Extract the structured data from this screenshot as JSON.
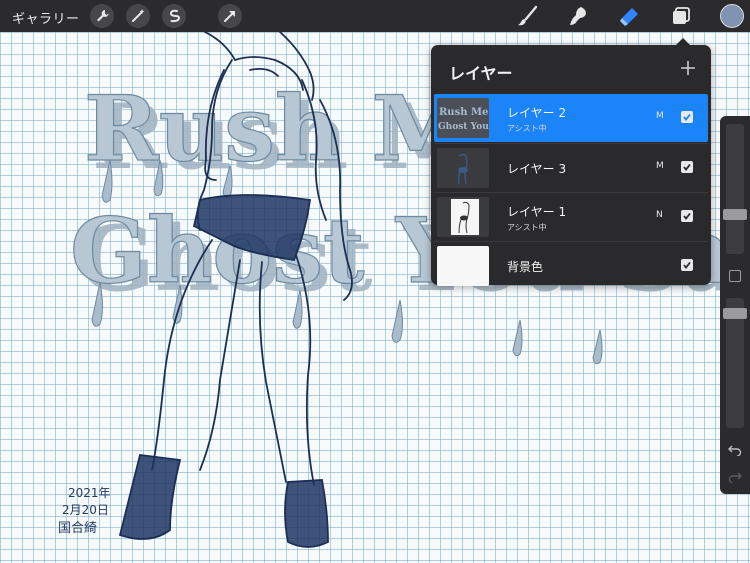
{
  "topbar": {
    "gallery_label": "ギャラリー",
    "left_tools": [
      "wrench-icon",
      "magic-wand-icon",
      "selection-icon",
      "transform-arrow-icon"
    ],
    "right_tools": [
      "brush-icon",
      "smudge-icon",
      "eraser-icon",
      "layers-icon"
    ],
    "active_tool": "eraser-icon",
    "current_color": "#7f93b3",
    "accent_color": "#2f86ff"
  },
  "layers_panel": {
    "title": "レイヤー",
    "add_icon": "plus-icon",
    "layers": [
      {
        "name": "レイヤー 2",
        "sub": "アシスト中",
        "mode": "M",
        "visible": true,
        "selected": true,
        "thumb_text": "Rush Me Ghost You Sa"
      },
      {
        "name": "レイヤー 3",
        "sub": "",
        "mode": "M",
        "visible": true,
        "selected": false
      },
      {
        "name": "レイヤー 1",
        "sub": "アシスト中",
        "mode": "N",
        "visible": true,
        "selected": false
      },
      {
        "name": "背景色",
        "sub": "",
        "mode": "",
        "visible": true,
        "selected": false
      }
    ],
    "selected_color": "#1a84f8"
  },
  "sidebar": {
    "brush_size_level": 0.6,
    "opacity_level": 0.08,
    "icons": [
      "modify-square-icon",
      "undo-icon",
      "redo-icon"
    ]
  },
  "canvas": {
    "artwork_text_line1": "Rush Me",
    "artwork_text_line2": "Ghost You Sa",
    "signature_lines": [
      "2021年",
      "2月20日",
      "国合綺"
    ]
  }
}
